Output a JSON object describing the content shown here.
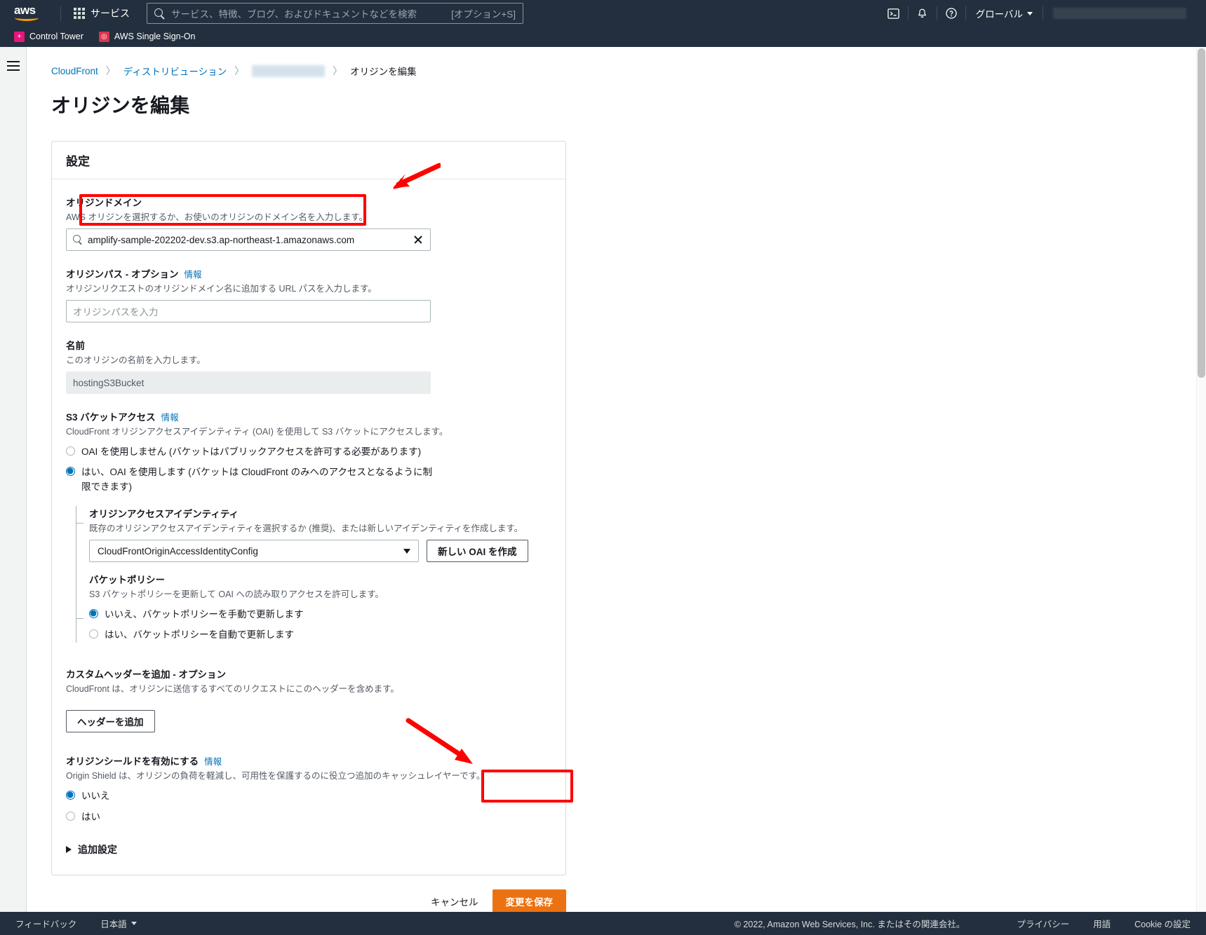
{
  "topnav": {
    "logo_alt": "aws",
    "services_label": "サービス",
    "search_placeholder": "サービス、特徴、ブログ、およびドキュメントなどを検索",
    "search_shortcut": "[オプション+S]",
    "cloudshell_icon": "cloudshell-icon",
    "bell_icon": "bell-icon",
    "help_icon": "help-icon",
    "region_label": "グローバル",
    "account_label": ""
  },
  "favbar": {
    "items": [
      {
        "label": "Control Tower",
        "badge": "+"
      },
      {
        "label": "AWS Single Sign-On",
        "badge": "◎"
      }
    ]
  },
  "breadcrumb": {
    "items": [
      {
        "label": "CloudFront",
        "type": "link"
      },
      {
        "label": "ディストリビューション",
        "type": "link"
      },
      {
        "label": "",
        "type": "redacted"
      },
      {
        "label": "オリジンを編集",
        "type": "current"
      }
    ],
    "separator": "〉"
  },
  "page": {
    "title": "オリジンを編集"
  },
  "card": {
    "heading": "設定"
  },
  "origin_domain": {
    "label": "オリジンドメイン",
    "description": "AWS オリジンを選択するか、お使いのオリジンのドメイン名を入力します。",
    "value": "amplify-sample-202202-dev.s3.ap-northeast-1.amazonaws.com",
    "clear_icon": "close-icon",
    "search_icon": "search-icon"
  },
  "origin_path": {
    "label": "オリジンパス - オプション",
    "info": "情報",
    "description": "オリジンリクエストのオリジンドメイン名に追加する URL パスを入力します。",
    "placeholder": "オリジンパスを入力",
    "value": ""
  },
  "name": {
    "label": "名前",
    "description": "このオリジンの名前を入力します。",
    "value": "hostingS3Bucket"
  },
  "bucket_access": {
    "label": "S3 バケットアクセス",
    "info": "情報",
    "description": "CloudFront オリジンアクセスアイデンティティ (OAI) を使用して S3 バケットにアクセスします。",
    "options": [
      {
        "label": "OAI を使用しません (バケットはパブリックアクセスを許可する必要があります)",
        "selected": false
      },
      {
        "label": "はい、OAI を使用します (バケットは CloudFront のみへのアクセスとなるように制限できます)",
        "selected": true
      }
    ]
  },
  "oai": {
    "label": "オリジンアクセスアイデンティティ",
    "description": "既存のオリジンアクセスアイデンティティを選択するか (推奨)、または新しいアイデンティティを作成します。",
    "selected_value": "CloudFrontOriginAccessIdentityConfig",
    "create_button": "新しい OAI を作成"
  },
  "bucket_policy": {
    "label": "バケットポリシー",
    "description": "S3 バケットポリシーを更新して OAI への読み取りアクセスを許可します。",
    "options": [
      {
        "label": "いいえ、バケットポリシーを手動で更新します",
        "selected": true
      },
      {
        "label": "はい、バケットポリシーを自動で更新します",
        "selected": false
      }
    ]
  },
  "custom_headers": {
    "label": "カスタムヘッダーを追加 - オプション",
    "description": "CloudFront は、オリジンに送信するすべてのリクエストにこのヘッダーを含めます。",
    "add_button": "ヘッダーを追加"
  },
  "origin_shield": {
    "label": "オリジンシールドを有効にする",
    "info": "情報",
    "description": "Origin Shield は、オリジンの負荷を軽減し、可用性を保護するのに役立つ追加のキャッシュレイヤーです。",
    "options": [
      {
        "label": "いいえ",
        "selected": true
      },
      {
        "label": "はい",
        "selected": false
      }
    ]
  },
  "additional_settings": {
    "label": "追加設定",
    "expanded": false
  },
  "actions": {
    "cancel": "キャンセル",
    "save": "変更を保存"
  },
  "footer": {
    "feedback": "フィードバック",
    "language": "日本語",
    "copyright": "© 2022, Amazon Web Services, Inc. またはその関連会社。",
    "privacy": "プライバシー",
    "terms": "用語",
    "cookies": "Cookie の設定"
  },
  "colors": {
    "nav_bg": "#232f3e",
    "link": "#0073bb",
    "primary_button": "#ec7211",
    "highlight": "#ff0000",
    "radio_selected": "#0073bb"
  }
}
